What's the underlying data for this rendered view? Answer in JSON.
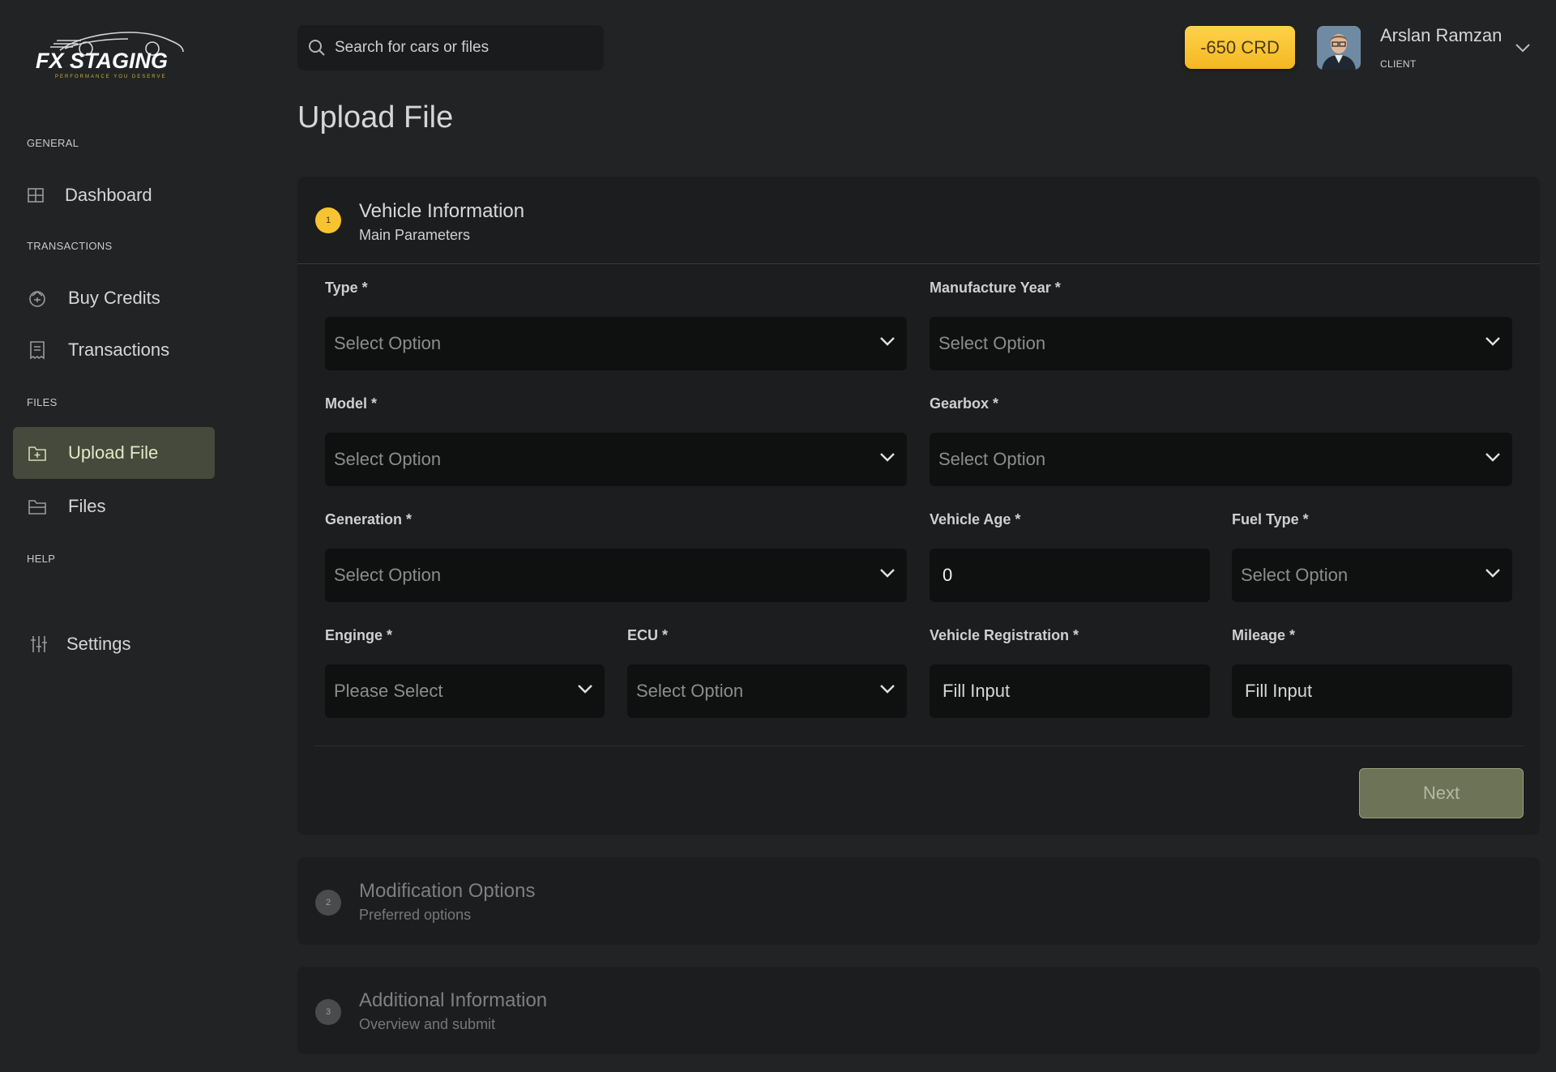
{
  "brand": {
    "name": "FX STAGING",
    "tagline": "PERFORMANCE YOU DESERVE"
  },
  "sidebar": {
    "sections": [
      "GENERAL",
      "TRANSACTIONS",
      "FILES",
      "HELP"
    ],
    "items": [
      {
        "label": "Dashboard",
        "icon": "grid-icon"
      },
      {
        "label": "Buy Credits",
        "icon": "credits-icon"
      },
      {
        "label": "Transactions",
        "icon": "receipt-icon"
      },
      {
        "label": "Upload File",
        "icon": "folder-plus-icon",
        "active": true
      },
      {
        "label": "Files",
        "icon": "folder-icon"
      },
      {
        "label": "Settings",
        "icon": "sliders-icon"
      }
    ]
  },
  "header": {
    "search_placeholder": "Search for cars or files",
    "credits": "-650 CRD",
    "user_name": "Arslan Ramzan",
    "user_role": "CLIENT"
  },
  "page": {
    "title": "Upload File"
  },
  "steps": [
    {
      "num": "1",
      "title": "Vehicle Information",
      "subtitle": "Main Parameters",
      "active": true
    },
    {
      "num": "2",
      "title": "Modification Options",
      "subtitle": "Preferred options"
    },
    {
      "num": "3",
      "title": "Additional Information",
      "subtitle": "Overview and submit"
    }
  ],
  "form": {
    "type": {
      "label": "Type *",
      "value": "Select Option"
    },
    "manufacture_year": {
      "label": "Manufacture Year *",
      "value": "Select Option"
    },
    "model": {
      "label": "Model *",
      "value": "Select Option"
    },
    "gearbox": {
      "label": "Gearbox *",
      "value": "Select Option"
    },
    "generation": {
      "label": "Generation *",
      "value": "Select Option"
    },
    "vehicle_age": {
      "label": "Vehicle Age *",
      "value": "0"
    },
    "fuel_type": {
      "label": "Fuel Type *",
      "value": "Select Option"
    },
    "engine": {
      "label": "Enginge *",
      "value": "Please Select"
    },
    "ecu": {
      "label": "ECU *",
      "value": "Select Option"
    },
    "vehicle_registration": {
      "label": "Vehicle Registration *",
      "placeholder": "Fill Input"
    },
    "mileage": {
      "label": "Mileage *",
      "placeholder": "Fill Input"
    },
    "next_label": "Next"
  },
  "colors": {
    "accent": "#f7c331",
    "active_nav": "#454a3c",
    "next_button": "#6c7356"
  }
}
